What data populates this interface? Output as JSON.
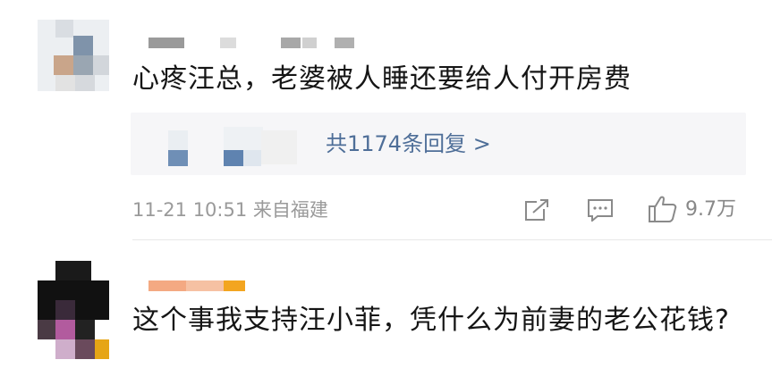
{
  "comments": [
    {
      "text": "心疼汪总，老婆被人睡还要给人付开房费",
      "replies_label": "共1174条回复 >",
      "time": "11-21 10:51",
      "location": "来自福建",
      "likes": "9.7万",
      "icons": [
        "share-icon",
        "comment-icon",
        "thumbs-up-icon"
      ]
    },
    {
      "text": "这个事我支持汪小菲，凭什么为前妻的老公花钱?"
    }
  ],
  "colors": {
    "text": "#151515",
    "link": "#4e6e98",
    "meta": "#9a9a9a",
    "reply_bg": "#f6f6f8"
  }
}
